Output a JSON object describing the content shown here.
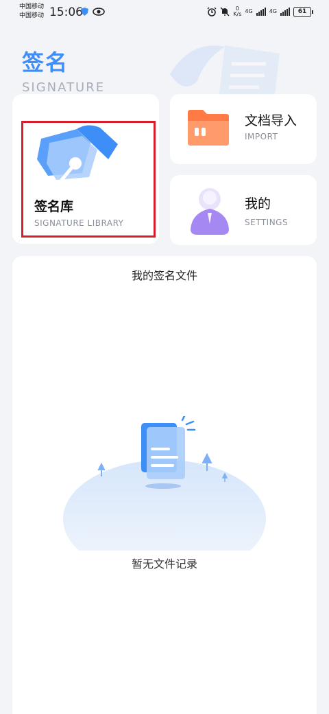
{
  "status_bar": {
    "carrier_1": "中国移动",
    "carrier_2": "中国移动",
    "time": "15:06",
    "net_speed_value": "0",
    "net_speed_unit": "K/s",
    "network_1": "4G",
    "network_2": "4G",
    "battery": "61"
  },
  "header": {
    "title": "签名",
    "subtitle": "SIGNATURE"
  },
  "cards": {
    "library": {
      "title": "签名库",
      "subtitle": "SIGNATURE LIBRARY",
      "icon": "fountain-pen-icon"
    },
    "import": {
      "title": "文档导入",
      "subtitle": "IMPORT",
      "icon": "folder-icon"
    },
    "settings": {
      "title": "我的",
      "subtitle": "SETTINGS",
      "icon": "profile-icon"
    }
  },
  "files_section": {
    "title": "我的签名文件",
    "empty_text": "暂无文件记录",
    "icon": "empty-document-icon"
  },
  "colors": {
    "accent": "#3d8ef7",
    "highlight_border": "#d81e2a",
    "import_orange": "#ff7a45",
    "settings_purple": "#9b7cf0"
  }
}
